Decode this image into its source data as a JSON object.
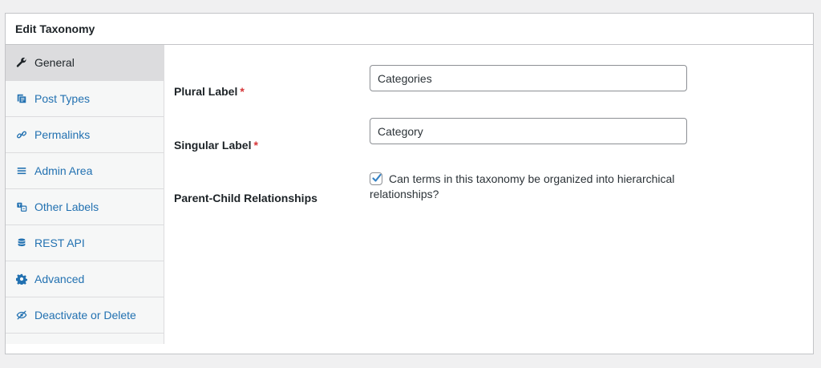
{
  "panel": {
    "title": "Edit Taxonomy"
  },
  "sidebar": {
    "items": [
      {
        "label": "General",
        "icon": "wrench-icon",
        "active": true
      },
      {
        "label": "Post Types",
        "icon": "admin-post-icon",
        "active": false
      },
      {
        "label": "Permalinks",
        "icon": "link-icon",
        "active": false
      },
      {
        "label": "Admin Area",
        "icon": "menu-icon",
        "active": false
      },
      {
        "label": "Other Labels",
        "icon": "translation-icon",
        "active": false
      },
      {
        "label": "REST API",
        "icon": "database-icon",
        "active": false
      },
      {
        "label": "Advanced",
        "icon": "gear-icon",
        "active": false
      },
      {
        "label": "Deactivate or Delete",
        "icon": "hidden-icon",
        "active": false
      }
    ]
  },
  "form": {
    "plural_label": {
      "label": "Plural Label",
      "required_mark": "*",
      "value": "Categories"
    },
    "singular_label": {
      "label": "Singular Label",
      "required_mark": "*",
      "value": "Category"
    },
    "parent_child": {
      "label": "Parent-Child Relationships",
      "checkbox_text": "Can terms in this taxonomy be organized into hierarchical relationships?",
      "checked": true
    }
  },
  "colors": {
    "link": "#2271b1",
    "required": "#d63638",
    "checkmark": "#3582c4",
    "active_nav_bg": "#dcdcde"
  }
}
